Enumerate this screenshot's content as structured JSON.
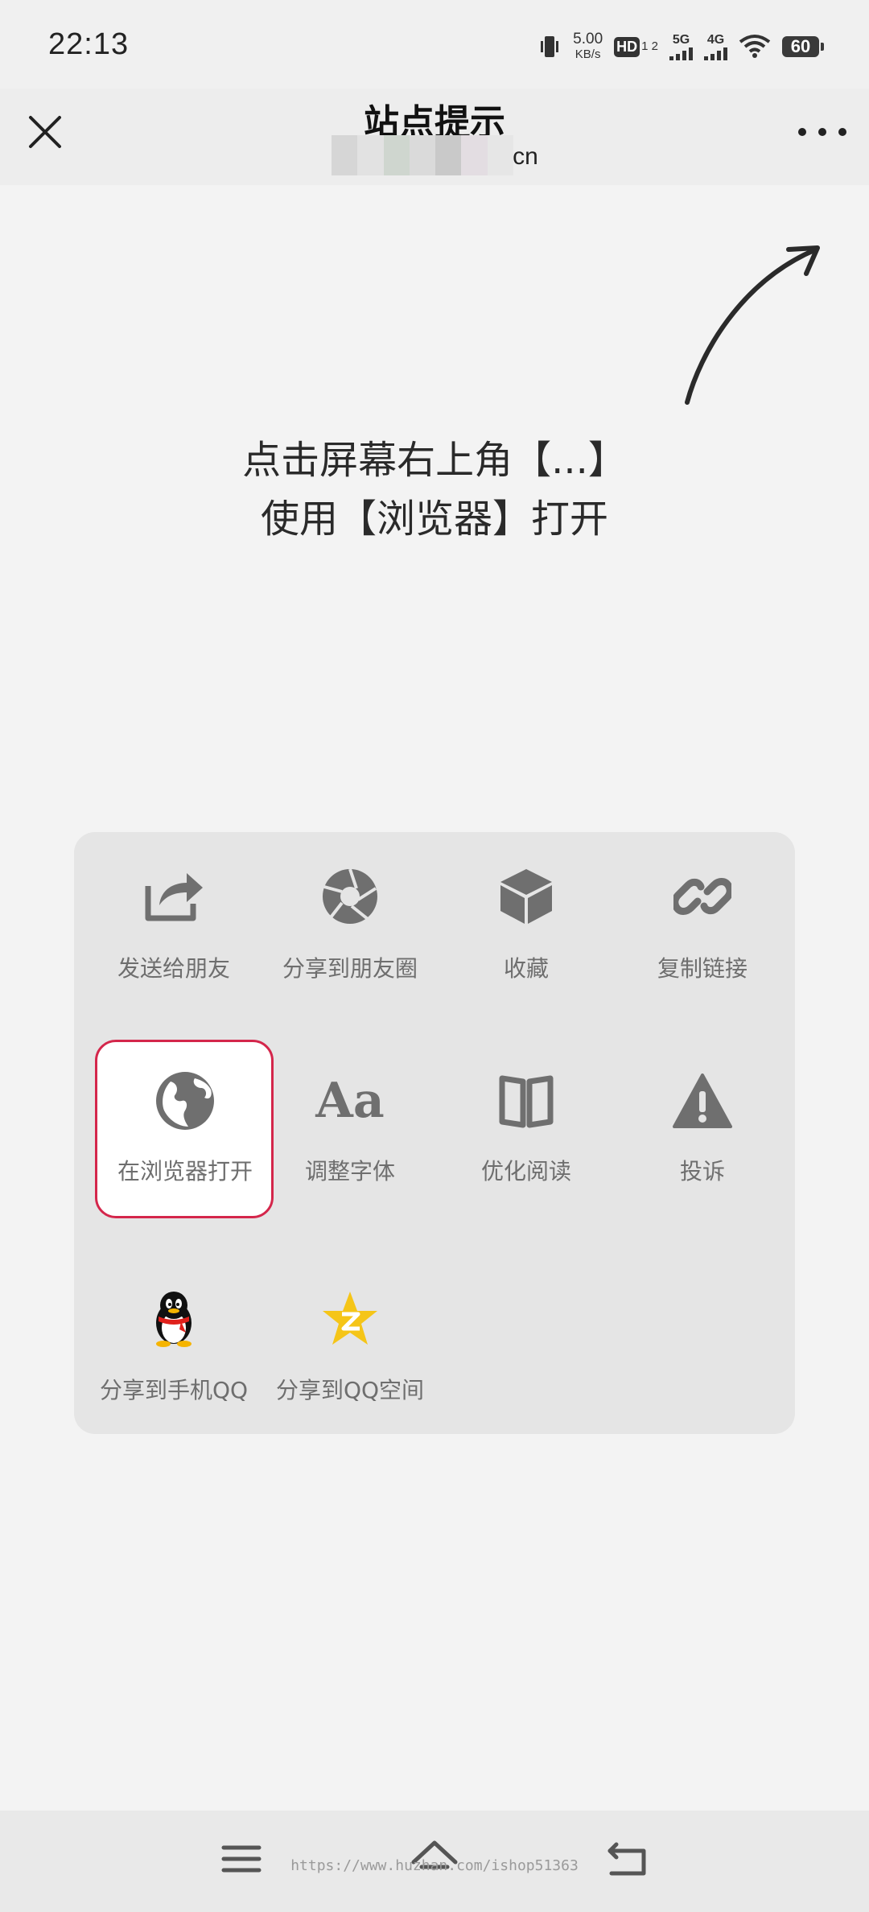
{
  "status_bar": {
    "time": "22:13",
    "net_speed_value": "5.00",
    "net_speed_unit": "KB/s",
    "hd_label": "HD",
    "hd_sub": "1 2",
    "network_5g": "5G",
    "network_4g": "4G",
    "battery": "60"
  },
  "nav": {
    "title": "站点提示",
    "url_visible": "cn"
  },
  "hint": {
    "line1": "点击屏幕右上角【...】",
    "line2": "使用【浏览器】打开"
  },
  "menu": {
    "row1": [
      {
        "label": "发送给朋友",
        "icon": "share-forward-icon"
      },
      {
        "label": "分享到朋友圈",
        "icon": "moments-shutter-icon"
      },
      {
        "label": "收藏",
        "icon": "favorite-cube-icon"
      },
      {
        "label": "复制链接",
        "icon": "link-icon"
      }
    ],
    "row2": [
      {
        "label": "在浏览器打开",
        "icon": "globe-icon"
      },
      {
        "label": "调整字体",
        "icon": "font-size-icon",
        "glyph": "Aa"
      },
      {
        "label": "优化阅读",
        "icon": "book-icon"
      },
      {
        "label": "投诉",
        "icon": "warning-icon"
      }
    ],
    "row3": [
      {
        "label": "分享到手机QQ",
        "icon": "qq-penguin-icon"
      },
      {
        "label": "分享到QQ空间",
        "icon": "qzone-star-icon"
      }
    ]
  },
  "colors": {
    "highlight_border": "#d4264b",
    "icon_gray": "#6f6f6f",
    "qzone_yellow": "#f5c518"
  },
  "watermark": "https://www.huzhan.com/ishop51363"
}
